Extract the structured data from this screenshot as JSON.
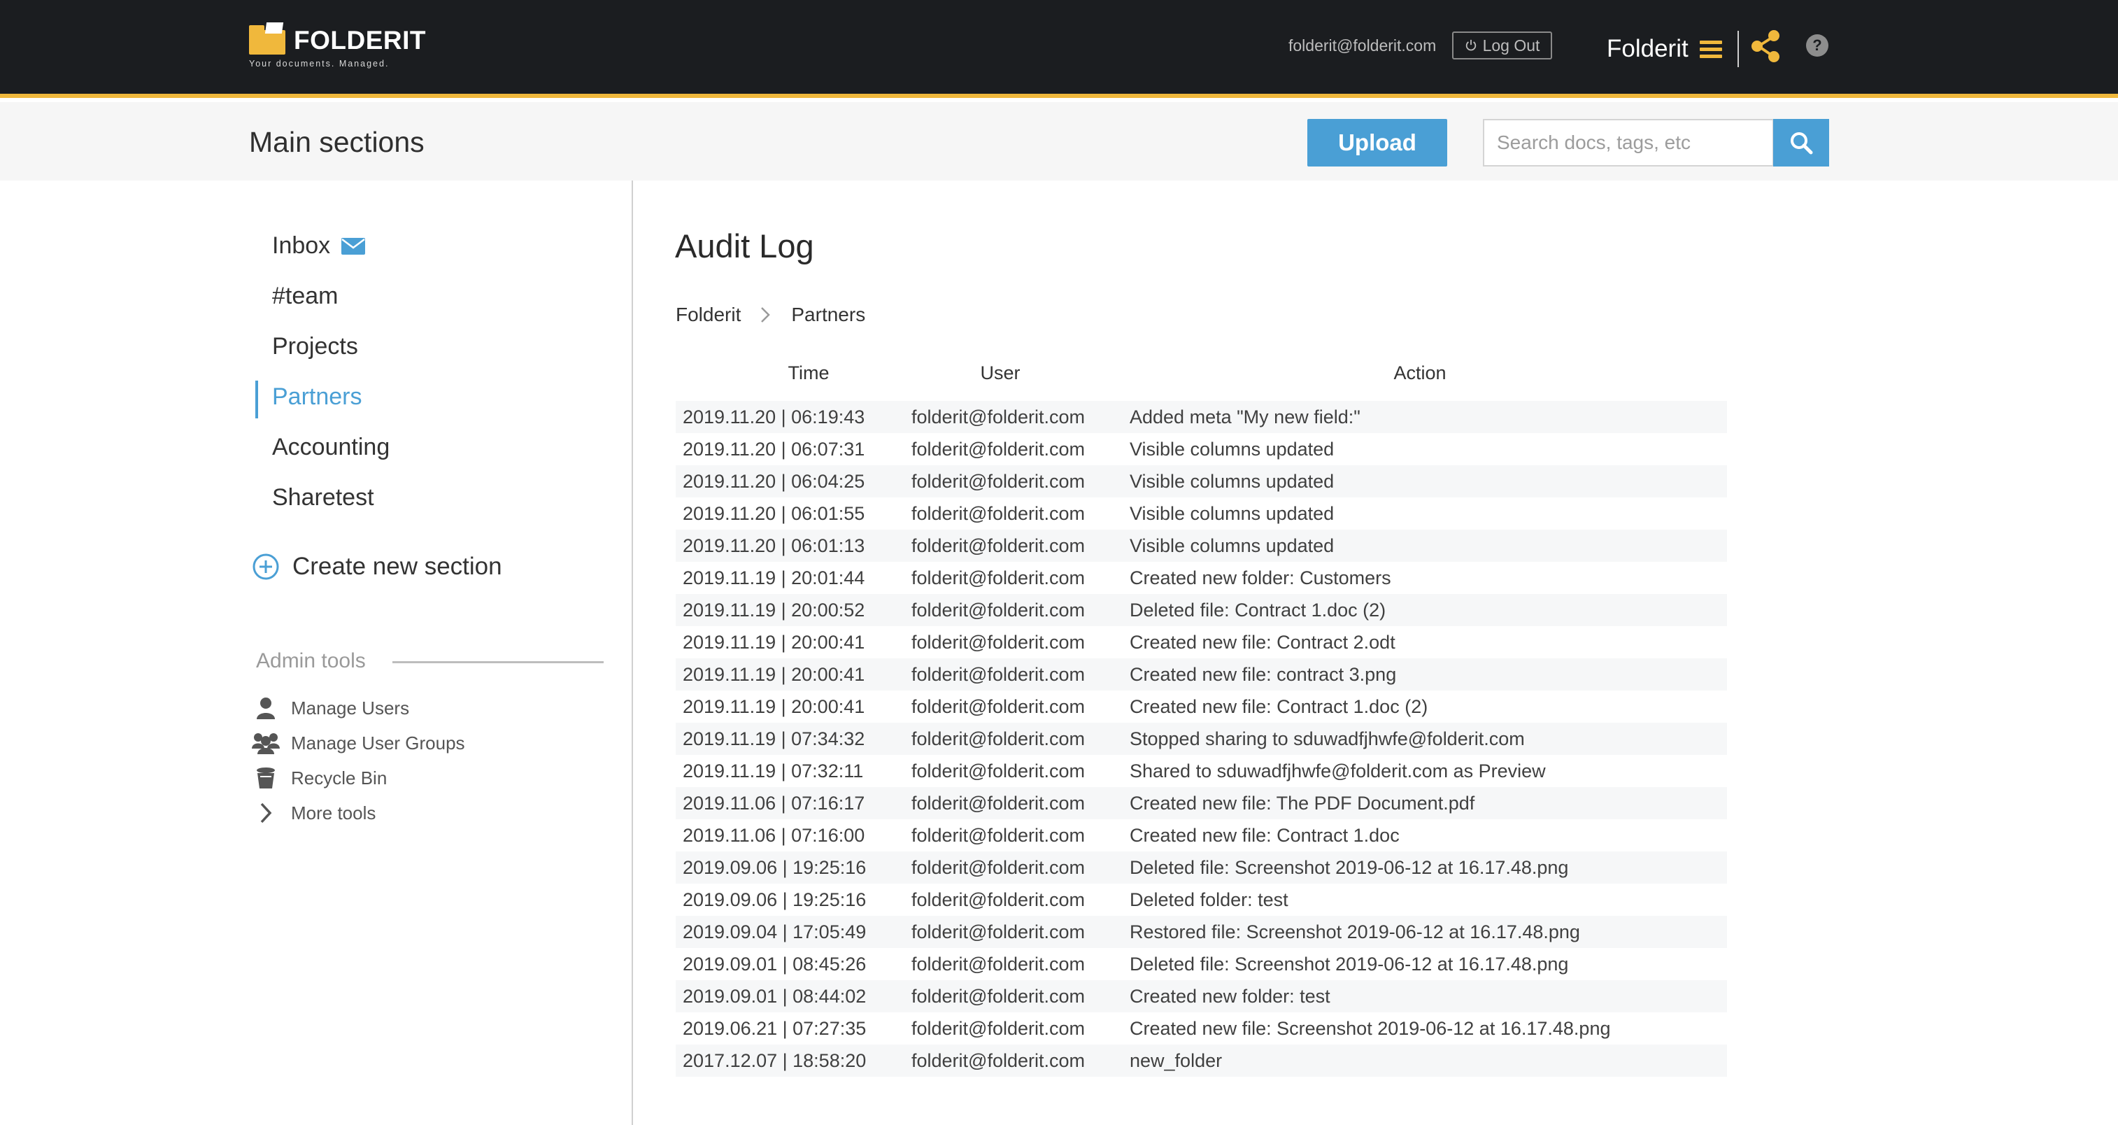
{
  "header": {
    "logo_text": "FOLDERIT",
    "tagline": "Your documents. Managed.",
    "user_email": "folderit@folderit.com",
    "logout_label": "Log Out",
    "org_name": "Folderit",
    "help_label": "?"
  },
  "subheader": {
    "title": "Main sections",
    "upload_label": "Upload",
    "search_placeholder": "Search docs, tags, etc"
  },
  "sidebar": {
    "items": [
      {
        "label": "Inbox"
      },
      {
        "label": "#team"
      },
      {
        "label": "Projects"
      },
      {
        "label": "Partners"
      },
      {
        "label": "Accounting"
      },
      {
        "label": "Sharetest"
      }
    ],
    "active_item": "Partners",
    "create_label": "Create new section",
    "admin_title": "Admin tools",
    "admin_items": [
      {
        "label": "Manage Users",
        "icon": "user-icon"
      },
      {
        "label": "Manage User Groups",
        "icon": "user-group-icon"
      },
      {
        "label": "Recycle Bin",
        "icon": "recycle-bin-icon"
      },
      {
        "label": "More tools",
        "icon": "chevron-right-icon"
      }
    ]
  },
  "main": {
    "title": "Audit Log",
    "breadcrumb": [
      "Folderit",
      "Partners"
    ],
    "columns": {
      "time": "Time",
      "user": "User",
      "action": "Action"
    },
    "rows": [
      {
        "time": "2019.11.20 | 06:19:43",
        "user": "folderit@folderit.com",
        "action": "Added meta \"My new field:\""
      },
      {
        "time": "2019.11.20 | 06:07:31",
        "user": "folderit@folderit.com",
        "action": "Visible columns updated"
      },
      {
        "time": "2019.11.20 | 06:04:25",
        "user": "folderit@folderit.com",
        "action": "Visible columns updated"
      },
      {
        "time": "2019.11.20 | 06:01:55",
        "user": "folderit@folderit.com",
        "action": "Visible columns updated"
      },
      {
        "time": "2019.11.20 | 06:01:13",
        "user": "folderit@folderit.com",
        "action": "Visible columns updated"
      },
      {
        "time": "2019.11.19 | 20:01:44",
        "user": "folderit@folderit.com",
        "action": "Created new folder: Customers"
      },
      {
        "time": "2019.11.19 | 20:00:52",
        "user": "folderit@folderit.com",
        "action": "Deleted file: Contract 1.doc (2)"
      },
      {
        "time": "2019.11.19 | 20:00:41",
        "user": "folderit@folderit.com",
        "action": "Created new file: Contract 2.odt"
      },
      {
        "time": "2019.11.19 | 20:00:41",
        "user": "folderit@folderit.com",
        "action": "Created new file: contract 3.png"
      },
      {
        "time": "2019.11.19 | 20:00:41",
        "user": "folderit@folderit.com",
        "action": "Created new file: Contract 1.doc (2)"
      },
      {
        "time": "2019.11.19 | 07:34:32",
        "user": "folderit@folderit.com",
        "action": "Stopped sharing to sduwadfjhwfe@folderit.com"
      },
      {
        "time": "2019.11.19 | 07:32:11",
        "user": "folderit@folderit.com",
        "action": "Shared to sduwadfjhwfe@folderit.com as Preview"
      },
      {
        "time": "2019.11.06 | 07:16:17",
        "user": "folderit@folderit.com",
        "action": "Created new file: The PDF Document.pdf"
      },
      {
        "time": "2019.11.06 | 07:16:00",
        "user": "folderit@folderit.com",
        "action": "Created new file: Contract 1.doc"
      },
      {
        "time": "2019.09.06 | 19:25:16",
        "user": "folderit@folderit.com",
        "action": "Deleted file: Screenshot 2019-06-12 at 16.17.48.png"
      },
      {
        "time": "2019.09.06 | 19:25:16",
        "user": "folderit@folderit.com",
        "action": "Deleted folder: test"
      },
      {
        "time": "2019.09.04 | 17:05:49",
        "user": "folderit@folderit.com",
        "action": "Restored file: Screenshot 2019-06-12 at 16.17.48.png"
      },
      {
        "time": "2019.09.01 | 08:45:26",
        "user": "folderit@folderit.com",
        "action": "Deleted file: Screenshot 2019-06-12 at 16.17.48.png"
      },
      {
        "time": "2019.09.01 | 08:44:02",
        "user": "folderit@folderit.com",
        "action": "Created new folder: test"
      },
      {
        "time": "2019.06.21 | 07:27:35",
        "user": "folderit@folderit.com",
        "action": "Created new file: Screenshot 2019-06-12 at 16.17.48.png"
      },
      {
        "time": "2017.12.07 | 18:58:20",
        "user": "folderit@folderit.com",
        "action": "new_folder"
      }
    ]
  },
  "colors": {
    "accent_blue": "#4a9fd5",
    "accent_yellow": "#f0b83c",
    "topbar_bg": "#1b1d20"
  }
}
